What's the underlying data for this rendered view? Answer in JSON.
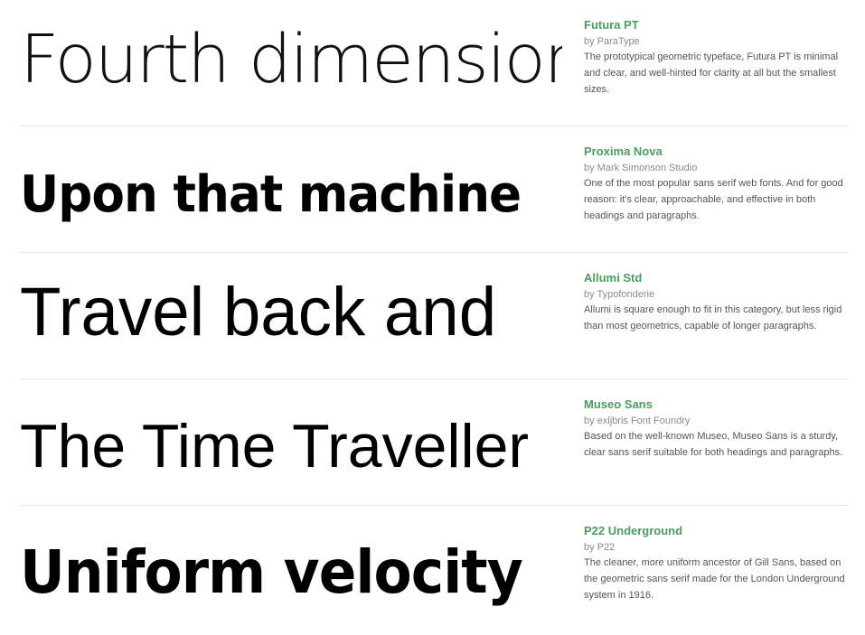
{
  "fonts": [
    {
      "sample": "Fourth dimension",
      "name": "Futura PT",
      "foundry": "by ParaType",
      "description": "The prototypical geometric typeface, Futura PT is minimal and clear, and well-hinted for clarity at all but the smallest sizes."
    },
    {
      "sample": "Upon that machine",
      "name": "Proxima Nova",
      "foundry": "by Mark Simonson Studio",
      "description": "One of the most popular sans serif web fonts. And for good reason: it's clear, approachable, and effective in both headings and paragraphs."
    },
    {
      "sample": "Travel back and",
      "name": "Allumi Std",
      "foundry": "by Typofonderie",
      "description": "Allumi is square enough to fit in this category, but less rigid than most geometrics, capable of longer paragraphs."
    },
    {
      "sample": "The Time Traveller",
      "name": "Museo Sans",
      "foundry": "by exljbris Font Foundry",
      "description": "Based on the well-known Museo, Museo Sans is a sturdy, clear sans serif suitable for both headings and paragraphs."
    },
    {
      "sample": "Uniform velocity",
      "name": "P22 Underground",
      "foundry": "by P22",
      "description": "The cleaner, more uniform ancestor of Gill Sans, based on the geometric sans serif made for the London Underground system in 1916."
    }
  ],
  "colors": {
    "font_name": "#4a9d5f",
    "foundry": "#8a8a8a",
    "description": "#555555",
    "divider": "#e6e6e6"
  }
}
